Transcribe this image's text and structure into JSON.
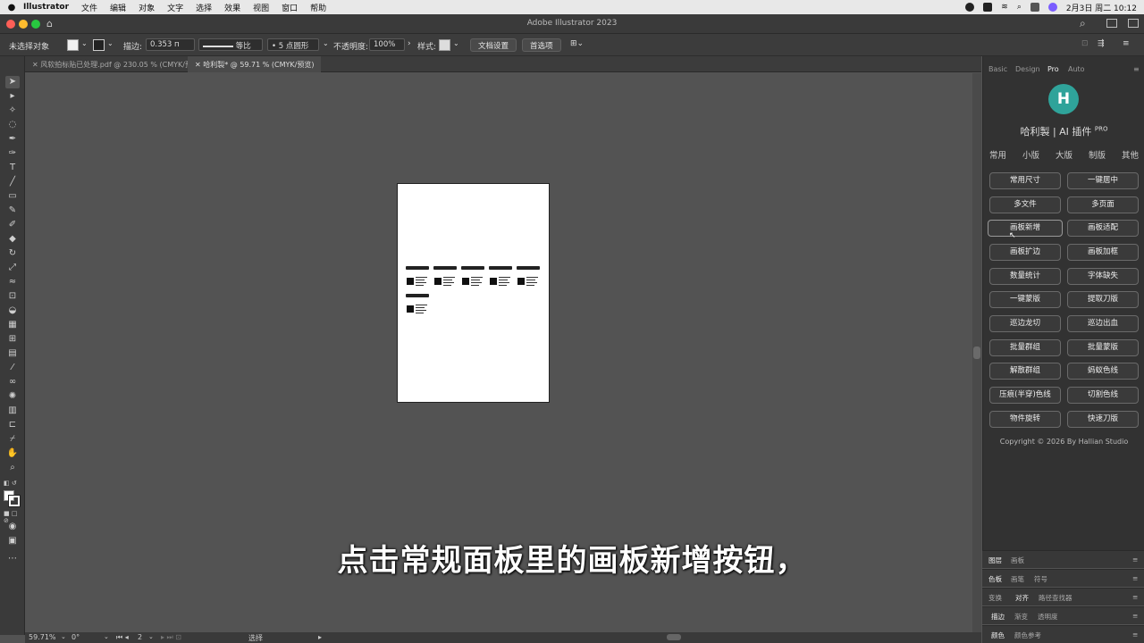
{
  "menubar": {
    "app": "Illustrator",
    "items": [
      "文件",
      "编辑",
      "对象",
      "文字",
      "选择",
      "效果",
      "视图",
      "窗口",
      "帮助"
    ],
    "clock": "2月3日 周二 10:12"
  },
  "window": {
    "title": "Adobe Illustrator 2023"
  },
  "controlbar": {
    "selection": "未选择对象",
    "stroke_label": "描边:",
    "stroke_value": "0.353 п",
    "stroke_profile": "等比",
    "brush": "5 点圆形",
    "opacity_label": "不透明度:",
    "opacity_value": "100%",
    "style_label": "样式:",
    "doc_setup": "文档设置",
    "preferences": "首选项"
  },
  "tabs": [
    {
      "label": "风软拍标贴已处理.pdf @ 230.05 % (CMYK/预览)",
      "active": false
    },
    {
      "label": "哈利製* @ 59.71 % (CMYK/预览)",
      "active": true
    }
  ],
  "panel": {
    "tabs": [
      "Basic",
      "Design",
      "Pro",
      "Auto"
    ],
    "active_tab": "Pro",
    "logo_text": "H",
    "title": "哈利製 | AI 插件",
    "title_sup": "PRO",
    "categories": [
      "常用",
      "小版",
      "大版",
      "制版",
      "其他"
    ],
    "buttons": [
      "常用尺寸",
      "一键居中",
      "多文件",
      "多页面",
      "画板新增",
      "画板适配",
      "画板扩边",
      "画板加框",
      "数量统计",
      "字体缺失",
      "一键蒙版",
      "提取刀版",
      "巡边龙切",
      "巡边出血",
      "批量群组",
      "批量蒙版",
      "解散群组",
      "蚂蚁色线",
      "压痕(半穿)色线",
      "切割色线",
      "物件旋转",
      "快速刀版"
    ],
    "copyright": "Copyright © 2026 By Hallian Studio"
  },
  "bottom_panels": [
    [
      "图层",
      "画板"
    ],
    [
      "色板",
      "画笔",
      "符号"
    ],
    [
      "变换",
      "对齐",
      "路径查找器"
    ],
    [
      "描边",
      "渐变",
      "透明度"
    ],
    [
      "颜色",
      "颜色参考"
    ]
  ],
  "statusbar": {
    "zoom": "59.71%",
    "rotation": "0°",
    "page": "2",
    "mode": "选择"
  },
  "subtitle": "点击常规面板里的画板新增按钮，"
}
